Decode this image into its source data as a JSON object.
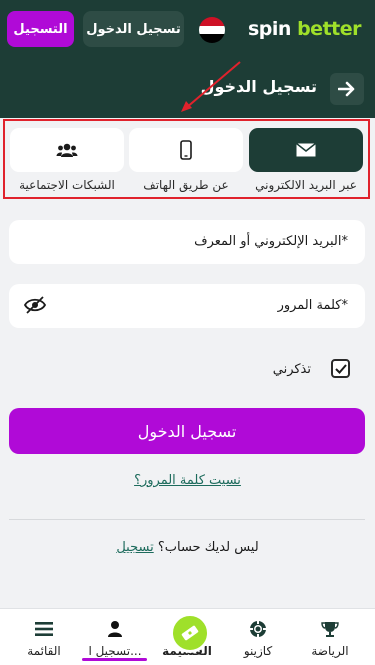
{
  "header": {
    "logo_spin": "spin",
    "logo_better": "better",
    "login_button": "تسجيل الدخول",
    "register_button": "التسجيل",
    "flag": "egypt-flag-icon"
  },
  "subheader": {
    "title": "تسجيل الدخول",
    "back_icon": "arrow-right-icon"
  },
  "tabs": [
    {
      "label": "عبر البريد الالكتروني",
      "icon": "envelope-icon",
      "active": true
    },
    {
      "label": "عن طريق الهاتف",
      "icon": "phone-icon",
      "active": false
    },
    {
      "label": "الشبكات الاجتماعية",
      "icon": "users-icon",
      "active": false
    }
  ],
  "form": {
    "email_label": "البريد الإلكتروني أو المعرف*",
    "password_label": "كلمة المرور*",
    "remember_label": "تذكرني",
    "remember_checked": true,
    "login_button": "تسجيل الدخول",
    "forgot_link": "نسيت كلمة المرور؟",
    "no_account_text": "ليس لديك حساب؟",
    "register_link": "تسجيل"
  },
  "bottom_nav": [
    {
      "label": "الرياضة",
      "icon": "trophy-icon"
    },
    {
      "label": "كازينو",
      "icon": "casino-chip-icon"
    },
    {
      "label": "القسيمة",
      "icon": "ticket-icon"
    },
    {
      "label": "تسجيل ا...",
      "icon": "user-icon"
    },
    {
      "label": "القائمة",
      "icon": "menu-icon"
    }
  ],
  "colors": {
    "header_bg": "#1d3d36",
    "accent_purple": "#b00ad7",
    "accent_green": "#9fe02a",
    "highlight_red": "#e0222c"
  }
}
